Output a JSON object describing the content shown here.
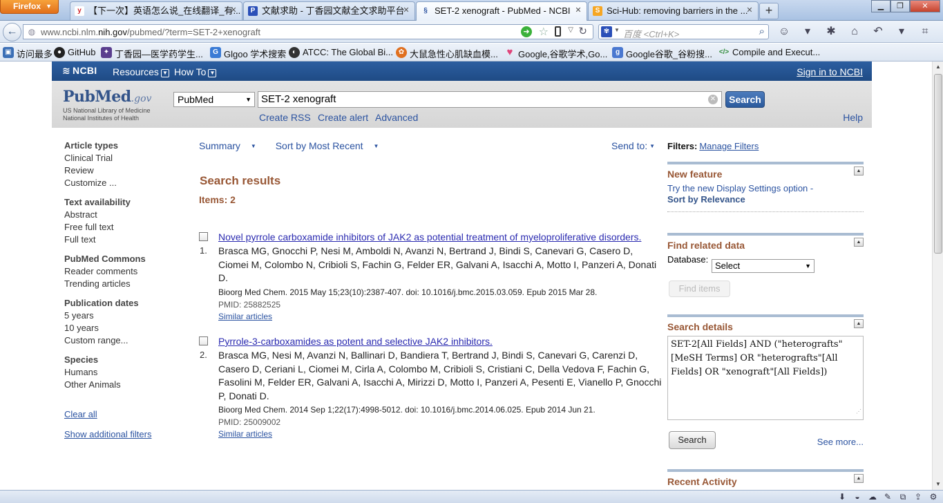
{
  "browser": {
    "app_button": "Firefox",
    "tabs": [
      {
        "title": "【下一次】英语怎么说_在线翻译_有...",
        "active": false
      },
      {
        "title": "文献求助 - 丁香园文献全文求助平台",
        "active": false
      },
      {
        "title": "SET-2 xenograft - PubMed - NCBI",
        "active": true
      },
      {
        "title": "Sci-Hub: removing barriers in the ...",
        "active": false
      }
    ],
    "url_prefix": "www.ncbi.nlm.",
    "url_domain": "nih.gov",
    "url_path": "/pubmed/?term=SET-2+xenograft",
    "search_placeholder": "百度 <Ctrl+K>",
    "bookmarks": [
      {
        "label": "访问最多",
        "color": "#3b6fb6"
      },
      {
        "label": "GitHub",
        "color": "#222222"
      },
      {
        "label": "丁香园—医学药学生...",
        "color": "#5a3e8e"
      },
      {
        "label": "Glgoo 学术搜索",
        "color": "#3a7bd5"
      },
      {
        "label": "ATCC: The Global Bi...",
        "color": "#333333"
      },
      {
        "label": "大鼠急性心肌缺血模...",
        "color": "#e07020"
      },
      {
        "label": "Google,谷歌学术,Go...",
        "color": "#e0457b"
      },
      {
        "label": "Google谷歌_谷粉搜...",
        "color": "#4a78d0"
      },
      {
        "label": "Compile and Execut...",
        "color": "#2e8b3a"
      }
    ]
  },
  "ncbi": {
    "logo": "NCBI",
    "resources": "Resources",
    "howto": "How To",
    "signin": "Sign in to NCBI"
  },
  "header": {
    "logo_pub": "Pub",
    "logo_med": "Med",
    "logo_gov": ".gov",
    "logo_sub1": "US National Library of Medicine",
    "logo_sub2": "National Institutes of Health",
    "database": "PubMed",
    "term": "SET-2 xenograft",
    "search_label": "Search",
    "create_rss": "Create RSS",
    "create_alert": "Create alert",
    "advanced": "Advanced",
    "help": "Help"
  },
  "filters": {
    "groups": [
      {
        "title": "Article types",
        "items": [
          "Clinical Trial",
          "Review",
          "Customize ..."
        ]
      },
      {
        "title": "Text availability",
        "items": [
          "Abstract",
          "Free full text",
          "Full text"
        ]
      },
      {
        "title": "PubMed Commons",
        "items": [
          "Reader comments",
          "Trending articles"
        ]
      },
      {
        "title": "Publication dates",
        "items": [
          "5 years",
          "10 years",
          "Custom range..."
        ]
      },
      {
        "title": "Species",
        "items": [
          "Humans",
          "Other Animals"
        ]
      }
    ],
    "clear_all": "Clear all",
    "show_additional": "Show additional filters"
  },
  "results_toolbar": {
    "format": "Summary",
    "sort": "Sort by Most Recent",
    "send_to": "Send to:"
  },
  "results": {
    "heading": "Search results",
    "count": "Items: 2",
    "items": [
      {
        "number": "1.",
        "title": "Novel pyrrole carboxamide inhibitors of JAK2 as potential treatment of myeloproliferative disorders.",
        "authors": "Brasca MG, Gnocchi P, Nesi M, Amboldi N, Avanzi N, Bertrand J, Bindi S, Canevari G, Casero D, Ciomei M, Colombo N, Cribioli S, Fachin G, Felder ER, Galvani A, Isacchi A, Motto I, Panzeri A, Donati D.",
        "journal": "Bioorg Med Chem. 2015 May 15;23(10):2387-407. doi: 10.1016/j.bmc.2015.03.059. Epub 2015 Mar 28.",
        "pmid": "PMID: 25882525",
        "similar": "Similar articles"
      },
      {
        "number": "2.",
        "title": "Pyrrole-3-carboxamides as potent and selective JAK2 inhibitors.",
        "authors": "Brasca MG, Nesi M, Avanzi N, Ballinari D, Bandiera T, Bertrand J, Bindi S, Canevari G, Carenzi D, Casero D, Ceriani L, Ciomei M, Cirla A, Colombo M, Cribioli S, Cristiani C, Della Vedova F, Fachin G, Fasolini M, Felder ER, Galvani A, Isacchi A, Mirizzi D, Motto I, Panzeri A, Pesenti E, Vianello P, Gnocchi P, Donati D.",
        "journal": "Bioorg Med Chem. 2014 Sep 1;22(17):4998-5012. doi: 10.1016/j.bmc.2014.06.025. Epub 2014 Jun 21.",
        "pmid": "PMID: 25009002",
        "similar": "Similar articles"
      }
    ]
  },
  "right": {
    "filters_label": "Filters:",
    "manage_filters": "Manage Filters",
    "new_feature": {
      "title": "New feature",
      "line1": "Try the new Display Settings option -",
      "line2": "Sort by Relevance"
    },
    "related": {
      "title": "Find related data",
      "db_label": "Database:",
      "db_value": "Select",
      "find_button": "Find items"
    },
    "details": {
      "title": "Search details",
      "query": "SET-2[All Fields] AND (\"heterografts\"[MeSH Terms] OR \"heterografts\"[All Fields] OR \"xenograft\"[All Fields])",
      "search_button": "Search",
      "see_more": "See more..."
    },
    "recent": {
      "title": "Recent Activity"
    }
  }
}
